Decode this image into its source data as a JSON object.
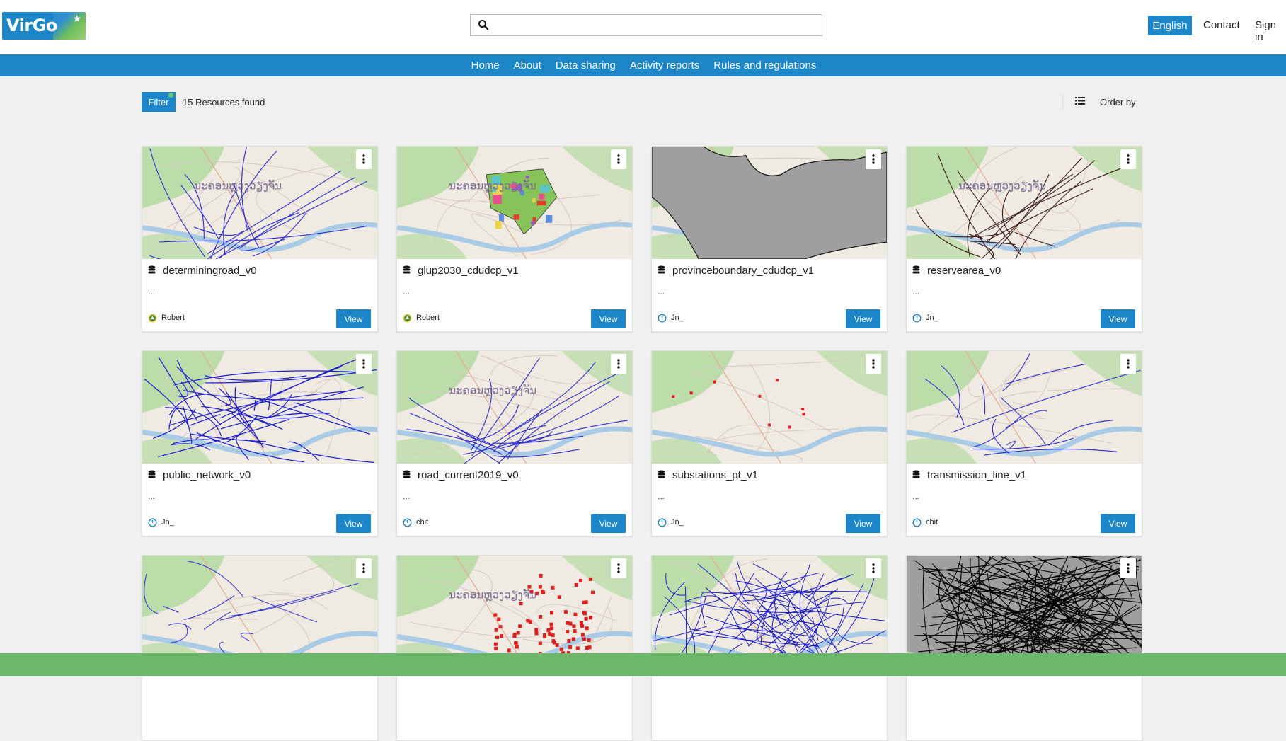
{
  "header": {
    "logo_text": "VirGo",
    "search_placeholder": "",
    "language": "English",
    "contact": "Contact",
    "sign_in": "Sign in"
  },
  "nav": {
    "items": [
      "Home",
      "About",
      "Data sharing",
      "Activity reports",
      "Rules and regulations"
    ]
  },
  "toolbar": {
    "filter_label": "Filter",
    "results": "15 Resources found",
    "order_by": "Order by"
  },
  "colors": {
    "primary": "#1d86c8",
    "footer": "#6bb86b",
    "map_land": "#efeae2",
    "map_green": "#bcdcaa",
    "map_water": "#aacbe6"
  },
  "cards": [
    {
      "title": "determiningroad_v0",
      "abstract": "...",
      "owner": "Robert",
      "owner_icon": "community-badge-icon",
      "view": "View",
      "thumb": "blue-roads",
      "map_label": "ນະຄອນຫຼວງວຽງຈັນ"
    },
    {
      "title": "glup2030_cdudcp_v1",
      "abstract": "...",
      "owner": "Robert",
      "owner_icon": "community-badge-icon",
      "view": "View",
      "thumb": "landuse-zones",
      "map_label": "ນະຄອນຫຼວງວຽງຈັນ"
    },
    {
      "title": "provinceboundary_cdudcp_v1",
      "abstract": "...",
      "owner": "Jn_",
      "owner_icon": "power-icon",
      "view": "View",
      "thumb": "grey-boundary",
      "map_label": ""
    },
    {
      "title": "reservearea_v0",
      "abstract": "...",
      "owner": "Jn_",
      "owner_icon": "power-icon",
      "view": "View",
      "thumb": "dark-roads",
      "map_label": "ນະຄອນຫຼວງວຽງຈັນ"
    },
    {
      "title": "public_network_v0",
      "abstract": "...",
      "owner": "Jn_",
      "owner_icon": "power-icon",
      "view": "View",
      "thumb": "dense-blue-network",
      "map_label": ""
    },
    {
      "title": "road_current2019_v0",
      "abstract": "...",
      "owner": "chit",
      "owner_icon": "power-icon",
      "view": "View",
      "thumb": "blue-roads",
      "map_label": "ນະຄອນຫຼວງວຽງຈັນ"
    },
    {
      "title": "substations_pt_v1",
      "abstract": "...",
      "owner": "Jn_",
      "owner_icon": "power-icon",
      "view": "View",
      "thumb": "red-points-sparse",
      "map_label": ""
    },
    {
      "title": "transmission_line_v1",
      "abstract": "...",
      "owner": "chit",
      "owner_icon": "power-icon",
      "view": "View",
      "thumb": "transmission-lines",
      "map_label": ""
    },
    {
      "title": "",
      "abstract": "",
      "owner": "",
      "owner_icon": "",
      "view": "",
      "thumb": "blue-roads-sparse",
      "map_label": ""
    },
    {
      "title": "",
      "abstract": "",
      "owner": "",
      "owner_icon": "",
      "view": "",
      "thumb": "red-points-dense",
      "map_label": "ນະຄອນຫຼວງວຽງຈັນ"
    },
    {
      "title": "",
      "abstract": "",
      "owner": "",
      "owner_icon": "",
      "view": "",
      "thumb": "dense-blue-rivers",
      "map_label": ""
    },
    {
      "title": "",
      "abstract": "",
      "owner": "",
      "owner_icon": "",
      "view": "",
      "thumb": "black-dense",
      "map_label": ""
    }
  ]
}
